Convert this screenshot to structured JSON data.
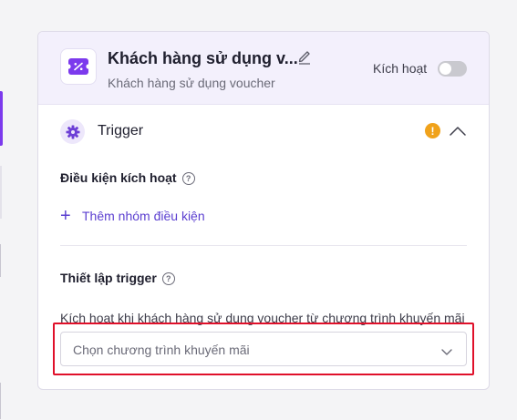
{
  "header": {
    "title": "Khách hàng sử dụng v...",
    "subtitle": "Khách hàng sử dụng voucher",
    "toggle_label": "Kích hoạt",
    "toggle_on": false
  },
  "trigger": {
    "label": "Trigger"
  },
  "conditions": {
    "title": "Điều kiện kích hoạt",
    "add_group_label": "Thêm nhóm điều kiện"
  },
  "setup": {
    "title": "Thiết lập trigger",
    "description": "Kích hoạt khi khách hàng sử dụng voucher từ chương trình khuyến mãi",
    "select_placeholder": "Chọn chương trình khuyến mãi"
  },
  "colors": {
    "accent": "#5b3fd0",
    "warning": "#f0a21b",
    "highlight": "#e0102a"
  },
  "icons": [
    "voucher-icon",
    "edit-icon",
    "gear-icon",
    "warning-icon",
    "chevron-up-icon",
    "help-icon",
    "plus-icon",
    "chevron-down-icon"
  ]
}
